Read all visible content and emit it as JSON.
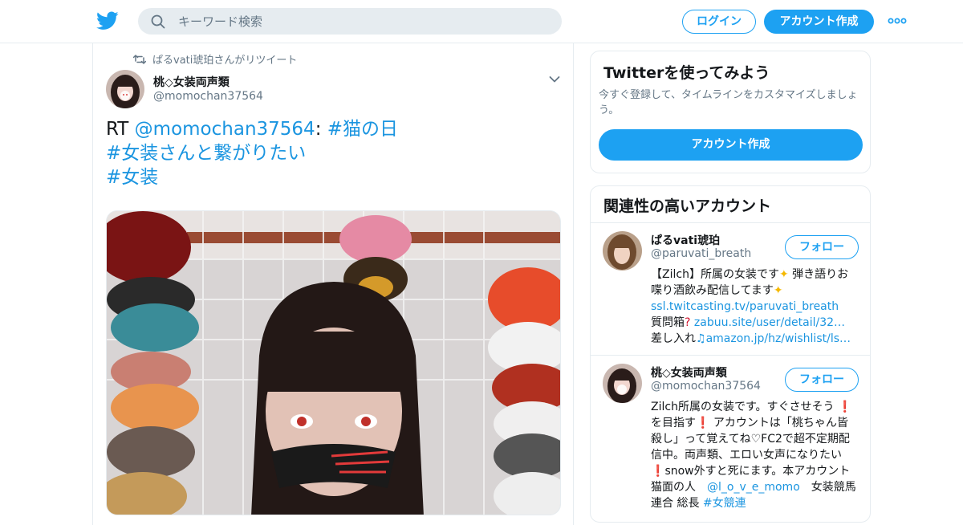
{
  "header": {
    "search_placeholder": "キーワード検索",
    "login_label": "ログイン",
    "signup_label": "アカウント作成"
  },
  "tweet": {
    "retweeted_by": "ぱるvati琥珀さんがリツイート",
    "author_name": "桃◇女装両声類",
    "author_handle": "@momochan37564",
    "text_rt": "RT ",
    "text_mention": "@momochan37564",
    "text_colon": ": ",
    "hashtag1": "#猫の日",
    "hashtag2": "#女装さんと繋がりたい",
    "hashtag3": "#女装"
  },
  "signup_card": {
    "title": "Twitterを使ってみよう",
    "subtitle": "今すぐ登録して、タイムラインをカスタマイズしましょう。",
    "button_label": "アカウント作成"
  },
  "related": {
    "title": "関連性の高いアカウント",
    "follow_label": "フォロー",
    "accounts": [
      {
        "name": "ぱるvati琥珀",
        "handle": "@paruvati_breath",
        "bio_1": "【Zilch】所属の女装です",
        "bio_2": " 弾き語りお喋り酒飲み配信してます",
        "link_1": "ssl.twitcasting.tv/paruvati_breath",
        "bio_3": "　質問箱",
        "link_2": "zabuu.site/user/detail/32…",
        "bio_4": " 差し入れ",
        "link_3": "amazon.jp/hz/wishlist/ls…"
      },
      {
        "name": "桃◇女装両声類",
        "handle": "@momochan37564",
        "bio_1": "Zilch所属の女装です。すぐさせそう",
        "bio_2": "を目指す",
        "bio_3": " アカウントは「桃ちゃん皆殺し」って覚えてね♡FC2で超不定期配信中。両声類、エロい女声になりたい",
        "bio_4": "snow外すと死にます。本アカウント猫面の人　",
        "link_1": "@l_o_v_e_momo",
        "bio_5": "　女装競馬連合 総長 ",
        "link_2": "#女競連"
      }
    ]
  },
  "colors": {
    "accent": "#1da1f2",
    "link": "#1b95e0",
    "secondary_text": "#657786",
    "border": "#e6ecf0"
  },
  "icons": [
    "twitter-bird-icon",
    "search-icon",
    "more-dots-icon",
    "retweet-icon",
    "chevron-down-icon",
    "sparkles-icon",
    "exclamation-icon",
    "question-icon",
    "music-note-icon"
  ]
}
